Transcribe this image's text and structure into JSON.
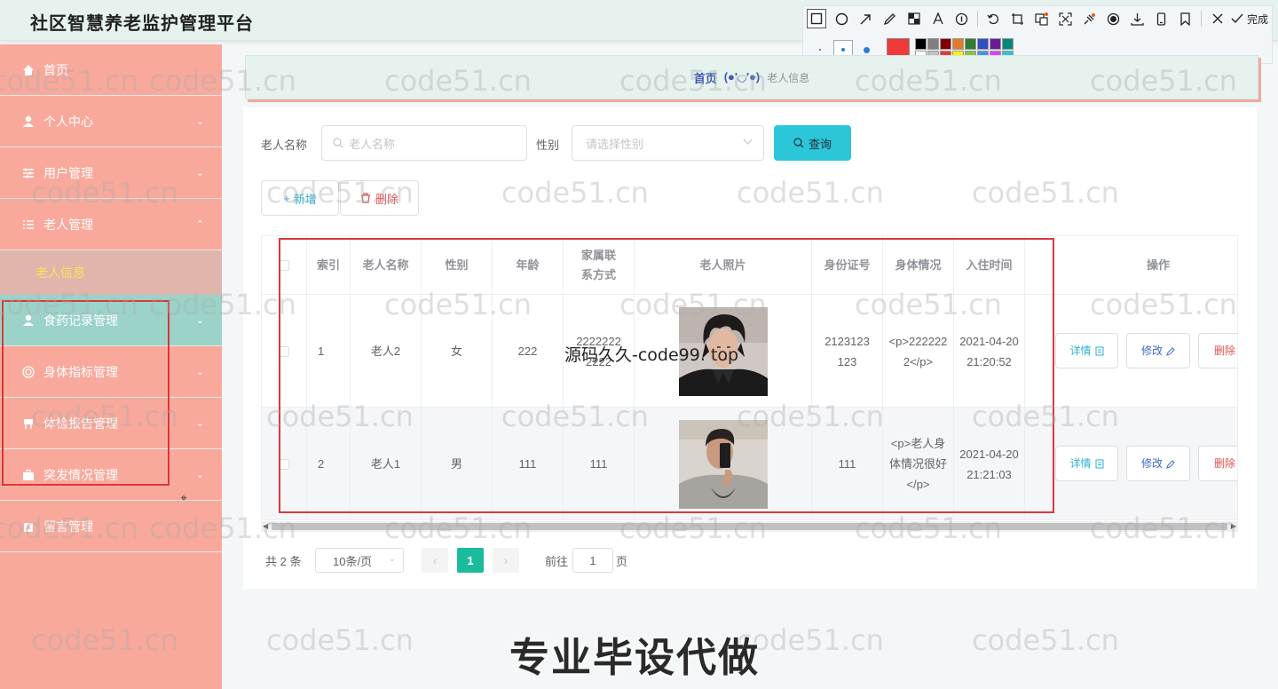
{
  "app": {
    "title": "社区智慧养老监护管理平台"
  },
  "annotation_toolbar": {
    "done_label": "完成",
    "tools": [
      "rect-icon",
      "circle-icon",
      "arrow-icon",
      "pen-icon",
      "mosaic-icon",
      "text-icon",
      "number-icon",
      "undo-icon",
      "crop-icon",
      "ocr-icon",
      "expand-icon",
      "pin-icon",
      "record-icon",
      "download-icon",
      "phone-icon",
      "bookmark-icon",
      "close-icon",
      "check-icon"
    ],
    "current_color": "#f03a3a",
    "palette": [
      "#000000",
      "#808080",
      "#800000",
      "#e07b2a",
      "#2e7d32",
      "#2f4fbf",
      "#6a1b9a",
      "#00897b",
      "#ffffff",
      "#c0c0c0",
      "#e53935",
      "#fff200",
      "#8bc34a",
      "#4a90e2",
      "#e040fb",
      "#26c6da"
    ]
  },
  "sidebar": {
    "items": [
      {
        "label": "首页",
        "icon": "home-icon",
        "arrow": ""
      },
      {
        "label": "个人中心",
        "icon": "user-icon",
        "arrow": "⌄"
      },
      {
        "label": "用户管理",
        "icon": "sliders-icon",
        "arrow": "⌄"
      },
      {
        "label": "老人管理",
        "icon": "list-icon",
        "arrow": "⌃"
      },
      {
        "label": "食药记录管理",
        "icon": "user-icon",
        "arrow": "⌄"
      },
      {
        "label": "身体指标管理",
        "icon": "target-icon",
        "arrow": "⌄"
      },
      {
        "label": "体检报告管理",
        "icon": "chair-icon",
        "arrow": "⌄"
      },
      {
        "label": "突发情况管理",
        "icon": "briefcase-icon",
        "arrow": "⌄"
      },
      {
        "label": "留言管理",
        "icon": "trash-icon",
        "arrow": ""
      }
    ],
    "submenu": {
      "label": "老人信息"
    }
  },
  "breadcrumb": {
    "home": "首页",
    "separator": "(●'◡'●)",
    "current": "老人信息"
  },
  "search": {
    "name_label": "老人名称",
    "name_placeholder": "老人名称",
    "gender_label": "性别",
    "gender_placeholder": "请选择性别",
    "query_label": "查询"
  },
  "actions": {
    "add_label": "新增",
    "delete_label": "删除"
  },
  "table": {
    "headers": [
      "索引",
      "老人名称",
      "性别",
      "年龄",
      "家属联系方式",
      "老人照片",
      "身份证号",
      "身体情况",
      "入住时间",
      "操作"
    ],
    "rows": [
      {
        "index": "1",
        "name": "老人2",
        "gender": "女",
        "age": "222",
        "contact": "22222222222",
        "id_no": "2123123123",
        "health": "<p>2222222</p>",
        "checkin": "2021-04-20 21:20:52"
      },
      {
        "index": "2",
        "name": "老人1",
        "gender": "男",
        "age": "111",
        "contact": "111",
        "id_no": "111",
        "health": "<p>老人身体情况很好</p>",
        "checkin": "2021-04-20 21:21:03"
      }
    ],
    "op_detail": "详情",
    "op_edit": "修改",
    "op_delete": "删除"
  },
  "pagination": {
    "total": "共 2 条",
    "page_size": "10条/页",
    "current_page": "1",
    "goto_label": "前往",
    "goto_value": "1",
    "page_suffix": "页"
  },
  "watermarks": {
    "repeated": "code51.cn",
    "overlay": "源码久久-code99. top",
    "bottom": "专业毕设代做"
  }
}
